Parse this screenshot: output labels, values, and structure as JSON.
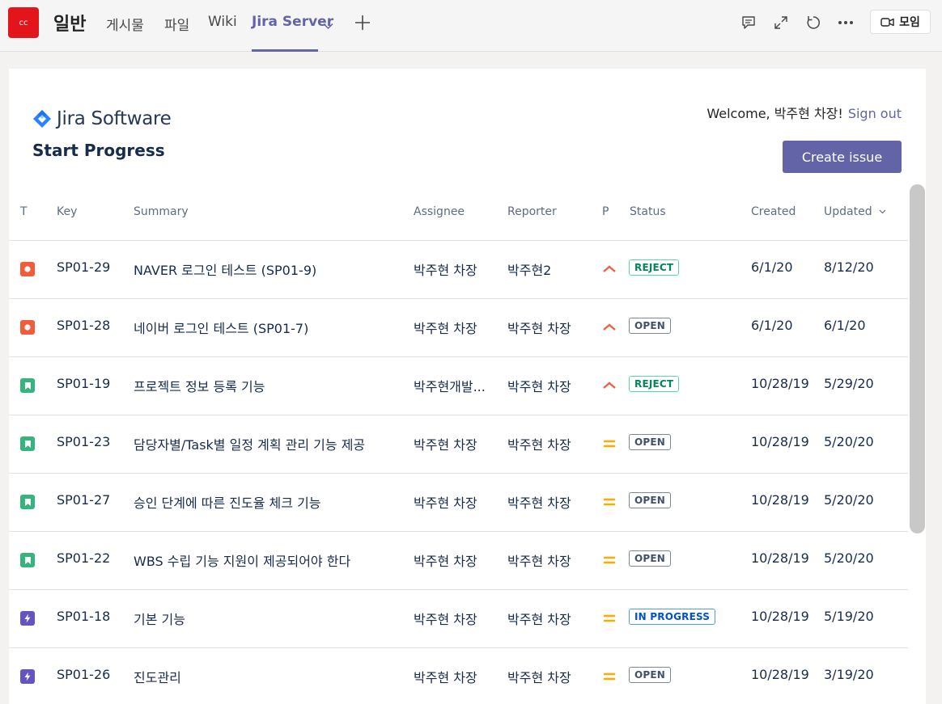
{
  "header": {
    "team_avatar": "cc",
    "channel": "일반",
    "tabs": [
      "게시물",
      "파일",
      "Wiki",
      "Jira Server"
    ],
    "active_tab": "Jira Server",
    "meet_label": "모임"
  },
  "jira": {
    "brand": "Jira Software",
    "page_title": "Start Progress",
    "welcome": "Welcome, 박주현 차장!",
    "sign_out": "Sign out",
    "create_label": "Create issue",
    "columns": {
      "type": "T",
      "key": "Key",
      "summary": "Summary",
      "assignee": "Assignee",
      "reporter": "Reporter",
      "priority": "P",
      "status": "Status",
      "created": "Created",
      "updated": "Updated"
    },
    "issues": [
      {
        "type": "bug",
        "key": "SP01-29",
        "summary": "NAVER 로그인 테스트 (SP01-9)",
        "assignee": "박주현 차장",
        "reporter": "박주현2",
        "priority": "high",
        "status": "REJECT",
        "created": "6/1/20",
        "updated": "8/12/20"
      },
      {
        "type": "bug",
        "key": "SP01-28",
        "summary": "네이버 로그인 테스트 (SP01-7)",
        "assignee": "박주현 차장",
        "reporter": "박주현 차장",
        "priority": "high",
        "status": "OPEN",
        "created": "6/1/20",
        "updated": "6/1/20"
      },
      {
        "type": "story",
        "key": "SP01-19",
        "summary": "프로젝트 정보 등록 기능",
        "assignee": "박주현개발...",
        "reporter": "박주현 차장",
        "priority": "high",
        "status": "REJECT",
        "created": "10/28/19",
        "updated": "5/29/20"
      },
      {
        "type": "story",
        "key": "SP01-23",
        "summary": "담당자별/Task별 일정 계획 관리 기능 제공",
        "assignee": "박주현 차장",
        "reporter": "박주현 차장",
        "priority": "medium",
        "status": "OPEN",
        "created": "10/28/19",
        "updated": "5/20/20"
      },
      {
        "type": "story",
        "key": "SP01-27",
        "summary": "승인 단계에 따른 진도율 체크 기능",
        "assignee": "박주현 차장",
        "reporter": "박주현 차장",
        "priority": "medium",
        "status": "OPEN",
        "created": "10/28/19",
        "updated": "5/20/20"
      },
      {
        "type": "story",
        "key": "SP01-22",
        "summary": "WBS 수립 기능 지원이 제공되어야 한다",
        "assignee": "박주현 차장",
        "reporter": "박주현 차장",
        "priority": "medium",
        "status": "OPEN",
        "created": "10/28/19",
        "updated": "5/20/20"
      },
      {
        "type": "epic",
        "key": "SP01-18",
        "summary": "기본 기능",
        "assignee": "박주현 차장",
        "reporter": "박주현 차장",
        "priority": "medium",
        "status": "IN PROGRESS",
        "created": "10/28/19",
        "updated": "5/19/20"
      },
      {
        "type": "epic",
        "key": "SP01-26",
        "summary": "진도관리",
        "assignee": "박주현 차장",
        "reporter": "박주현 차장",
        "priority": "medium",
        "status": "OPEN",
        "created": "10/28/19",
        "updated": "3/19/20"
      }
    ]
  },
  "colors": {
    "teams_accent": "#6264a7",
    "avatar": "#e3141a",
    "bug": "#f15c3b",
    "story": "#36b37e",
    "epic": "#6554c0",
    "priority_high": "#f15c3b",
    "priority_medium": "#ffab00"
  }
}
